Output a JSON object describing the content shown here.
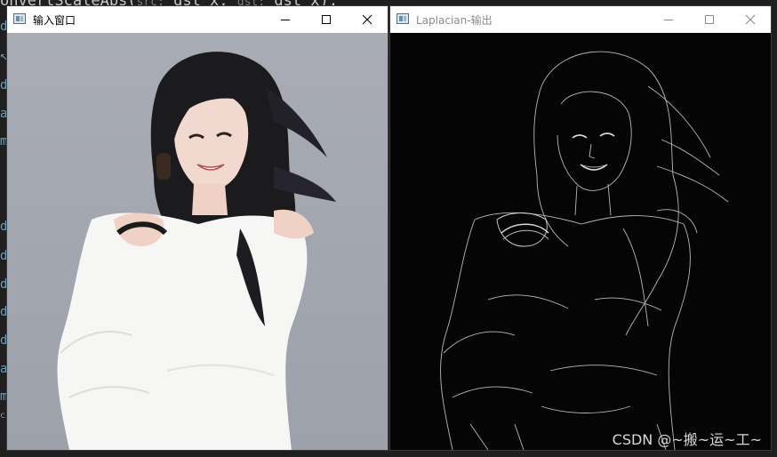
{
  "editor": {
    "top_line_code": "onvertScaleAbs(",
    "hint_src": "src:",
    "arg1": "dst_x,",
    "hint_dst": "dst:",
    "arg2": "dst_x);",
    "gutter_chars": [
      "d",
      "↖",
      "d",
      "a",
      "m",
      "d",
      "d",
      "d",
      "d",
      "d",
      "a",
      "m",
      "c"
    ]
  },
  "windows": [
    {
      "title": "输入窗口",
      "active": true
    },
    {
      "title": "Laplacian-输出",
      "active": false
    }
  ],
  "watermark": "CSDN @~搬~运~工~",
  "colors": {
    "editor_bg": "#1f1f1f",
    "titlebar": "#ffffff",
    "photo_bg": "#a5a9b1",
    "output_bg": "#050505"
  },
  "icons": [
    "app-icon",
    "minimize-icon",
    "maximize-icon",
    "close-icon"
  ]
}
